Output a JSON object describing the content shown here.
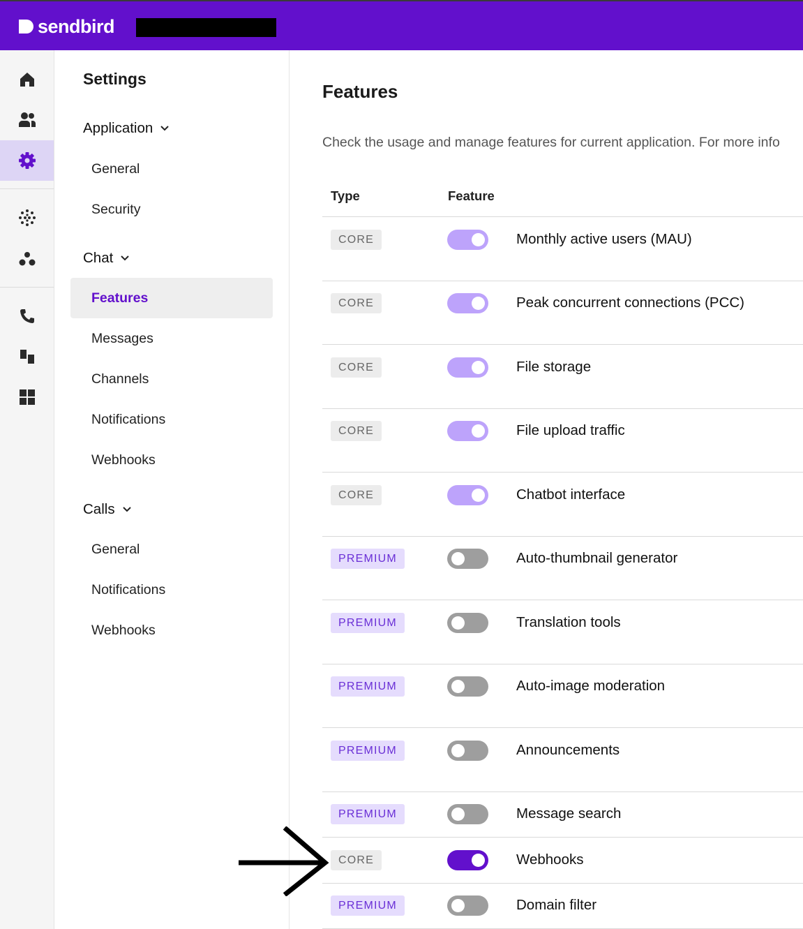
{
  "brand": {
    "name": "sendbird"
  },
  "rail": {
    "items": [
      {
        "icon": "home-icon",
        "active": false
      },
      {
        "icon": "users-icon",
        "active": false
      },
      {
        "icon": "gear-icon",
        "active": true
      },
      {
        "icon": "dots-circle-icon",
        "active": false
      },
      {
        "icon": "nodes-icon",
        "active": false
      },
      {
        "icon": "phone-icon",
        "active": false
      },
      {
        "icon": "blocks-icon",
        "active": false
      },
      {
        "icon": "grid-icon",
        "active": false
      }
    ]
  },
  "nav": {
    "title": "Settings",
    "groups": [
      {
        "label": "Application",
        "items": [
          "General",
          "Security"
        ]
      },
      {
        "label": "Chat",
        "items": [
          "Features",
          "Messages",
          "Channels",
          "Notifications",
          "Webhooks"
        ]
      },
      {
        "label": "Calls",
        "items": [
          "General",
          "Notifications",
          "Webhooks"
        ]
      }
    ],
    "active_item": "Features"
  },
  "main": {
    "title": "Features",
    "description": "Check the usage and manage features for current application. For more info",
    "columns": [
      "Type",
      "Feature"
    ],
    "rows": [
      {
        "type": "CORE",
        "enabled": true,
        "feature": "Monthly active users (MAU)"
      },
      {
        "type": "CORE",
        "enabled": true,
        "feature": "Peak concurrent connections (PCC)"
      },
      {
        "type": "CORE",
        "enabled": true,
        "feature": "File storage"
      },
      {
        "type": "CORE",
        "enabled": true,
        "feature": "File upload traffic"
      },
      {
        "type": "CORE",
        "enabled": true,
        "feature": "Chatbot interface"
      },
      {
        "type": "PREMIUM",
        "enabled": false,
        "feature": "Auto-thumbnail generator"
      },
      {
        "type": "PREMIUM",
        "enabled": false,
        "feature": "Translation tools"
      },
      {
        "type": "PREMIUM",
        "enabled": false,
        "feature": "Auto-image moderation"
      },
      {
        "type": "PREMIUM",
        "enabled": false,
        "feature": "Announcements"
      },
      {
        "type": "PREMIUM",
        "enabled": false,
        "feature": "Message search"
      },
      {
        "type": "CORE",
        "enabled": true,
        "feature": "Webhooks"
      },
      {
        "type": "PREMIUM",
        "enabled": false,
        "feature": "Domain filter"
      }
    ]
  },
  "colors": {
    "brand_purple": "#6210cc",
    "toggle_on_light": "#bda3fb",
    "toggle_off": "#9e9e9e",
    "premium_badge_bg": "#e5dcfd",
    "core_badge_bg": "#ececec"
  }
}
